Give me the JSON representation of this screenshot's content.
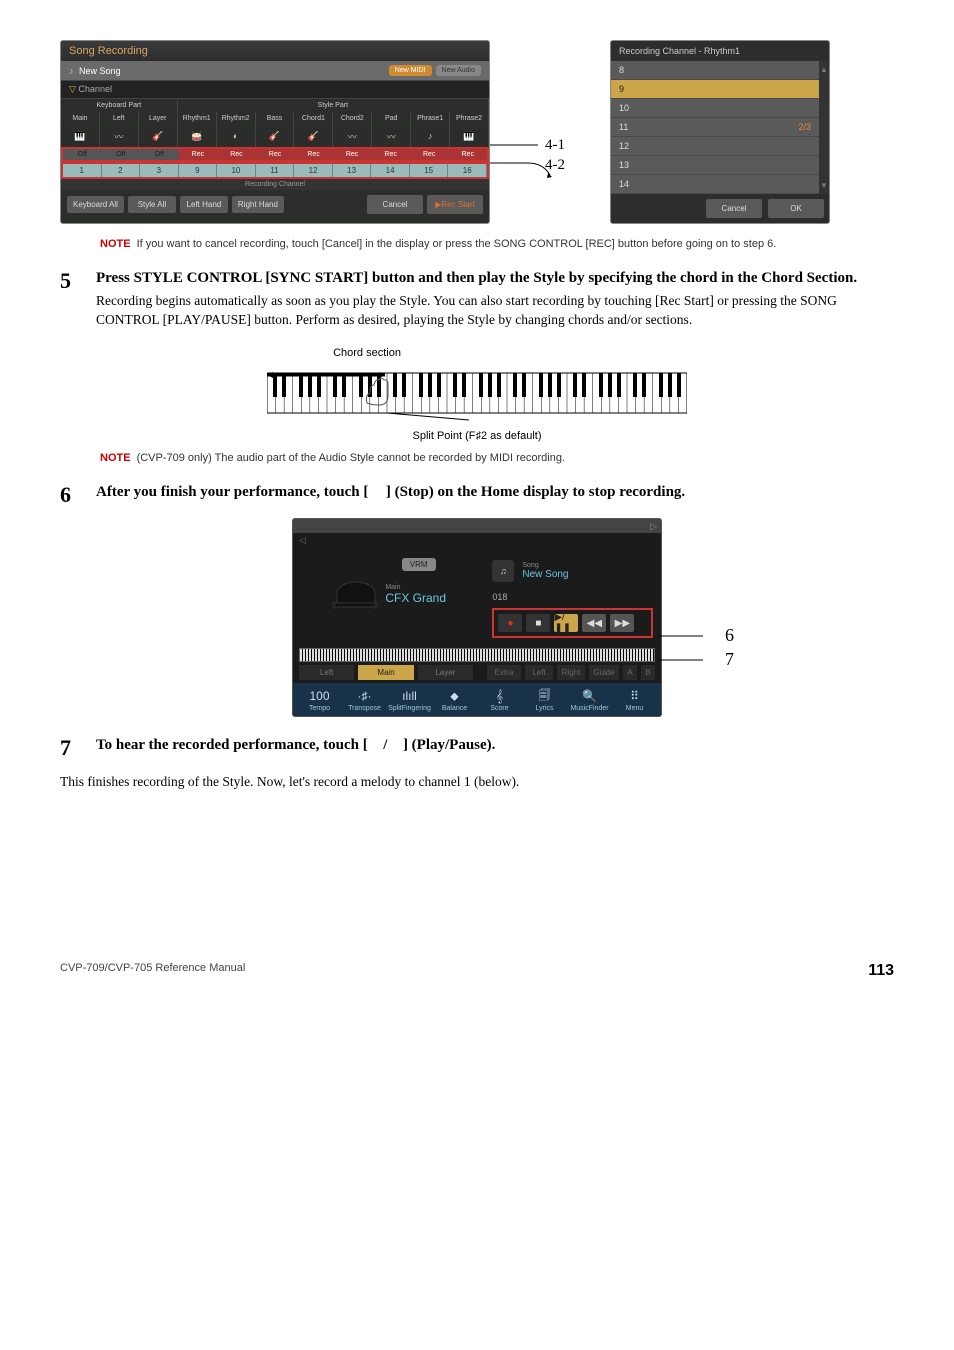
{
  "panel_left": {
    "title": "Song Recording",
    "song_label": "New Song",
    "pill_midi": "New MIDI",
    "pill_audio": "New Audio",
    "channel_label": "Channel",
    "kbd_part_header": "Keyboard Part",
    "style_part_header": "Style Part",
    "part_cols": [
      "Main",
      "Left",
      "Layer",
      "Rhythm1",
      "Rhythm2",
      "Bass",
      "Chord1",
      "Chord2",
      "Pad",
      "Phrase1",
      "Phrase2"
    ],
    "rec_row": [
      "Off",
      "Off",
      "Off",
      "Rec",
      "Rec",
      "Rec",
      "Rec",
      "Rec",
      "Rec",
      "Rec",
      "Rec"
    ],
    "num_row": [
      "1",
      "2",
      "3",
      "9",
      "10",
      "11",
      "12",
      "13",
      "14",
      "15",
      "16"
    ],
    "rec_ch_label": "Recording Channel",
    "btn_kbd_all": "Keyboard All",
    "btn_style_all": "Style All",
    "btn_left_hand": "Left Hand",
    "btn_right_hand": "Right Hand",
    "btn_cancel": "Cancel",
    "btn_rec": "▶Rec Start"
  },
  "callouts": {
    "c41": "4-1",
    "c42": "4-2",
    "c6": "6",
    "c7": "7"
  },
  "panel_right": {
    "title": "Recording Channel - Rhythm1",
    "rows": [
      "8",
      "9",
      "10",
      "11",
      "12",
      "13",
      "14"
    ],
    "active_index": 1,
    "page_indicator": "2/3",
    "btn_cancel": "Cancel",
    "btn_ok": "OK"
  },
  "note1": {
    "label": "NOTE",
    "text": "If you want to cancel recording, touch [Cancel] in the display or press the SONG CONTROL [REC] button before going on to step 6."
  },
  "step5": {
    "num": "5",
    "title": "Press STYLE CONTROL [SYNC START] button and then play the Style by specifying the chord in the Chord Section.",
    "text": "Recording begins automatically as soon as you play the Style. You can also start recording by touching [Rec Start] or pressing the SONG CONTROL [PLAY/PAUSE] button. Perform as desired, playing the Style by changing chords and/or sections."
  },
  "kbfig": {
    "chord_label": "Chord section",
    "split_label": "Split Point (F♯2 as default)"
  },
  "note2": {
    "label": "NOTE",
    "text": "(CVP-709 only) The audio part of the Audio Style cannot be recorded by MIDI recording."
  },
  "step6": {
    "num": "6",
    "title_a": "After you finish your performance, touch [",
    "title_b": "] (Stop) on the Home display to stop recording."
  },
  "home": {
    "vrm": "VRM",
    "main_label": "Main",
    "voice": "CFX Grand",
    "song_label": "Song",
    "song_name": "New Song",
    "counter": "018",
    "tabs_left": [
      "Left",
      "Main",
      "Layer"
    ],
    "tabs_right": [
      "Extra",
      "Left",
      "Right",
      "Guide",
      "A",
      "B"
    ],
    "bottom": [
      {
        "glyph": "100",
        "label": "Tempo"
      },
      {
        "glyph": "·♯·",
        "label": "Transpose"
      },
      {
        "glyph": "ılıll",
        "label": "SplitFingering"
      },
      {
        "glyph": "⬥",
        "label": "Balance"
      },
      {
        "glyph": "𝄞",
        "label": "Score"
      },
      {
        "glyph": "🗐",
        "label": "Lyrics"
      },
      {
        "glyph": "🔍",
        "label": "MusicFinder"
      },
      {
        "glyph": "⠿",
        "label": "Menu"
      }
    ]
  },
  "step7": {
    "num": "7",
    "title_a": "To hear the recorded performance, touch [",
    "title_b": "/",
    "title_c": "] (Play/Pause)."
  },
  "closing": "This finishes recording of the Style. Now, let's record a melody to channel 1 (below).",
  "footer": {
    "manual": "CVP-709/CVP-705 Reference Manual",
    "page": "113"
  }
}
